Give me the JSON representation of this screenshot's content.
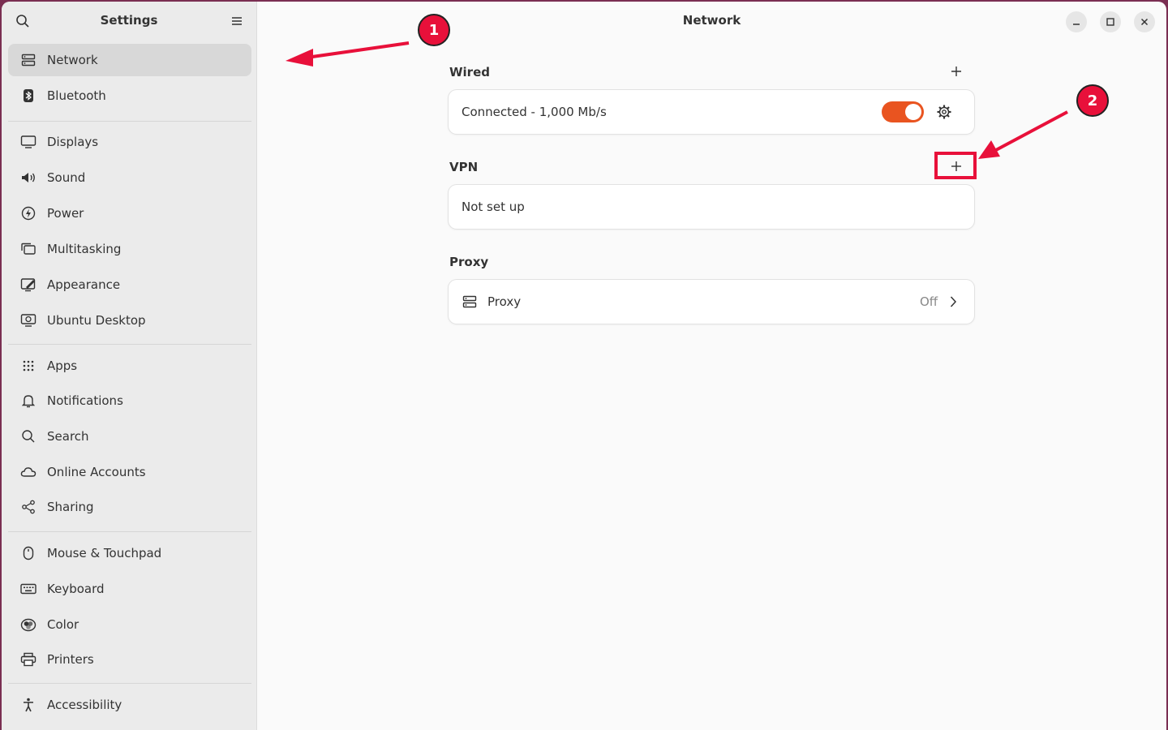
{
  "sidebar": {
    "title": "Settings",
    "items": [
      {
        "label": "Network",
        "icon": "network-icon",
        "selected": true
      },
      {
        "label": "Bluetooth",
        "icon": "bluetooth-icon"
      },
      {
        "label": "Displays",
        "icon": "display-icon"
      },
      {
        "label": "Sound",
        "icon": "speaker-icon"
      },
      {
        "label": "Power",
        "icon": "power-icon"
      },
      {
        "label": "Multitasking",
        "icon": "multitasking-icon"
      },
      {
        "label": "Appearance",
        "icon": "appearance-icon"
      },
      {
        "label": "Ubuntu Desktop",
        "icon": "ubuntu-desktop-icon"
      },
      {
        "label": "Apps",
        "icon": "apps-grid-icon"
      },
      {
        "label": "Notifications",
        "icon": "bell-icon"
      },
      {
        "label": "Search",
        "icon": "search-icon"
      },
      {
        "label": "Online Accounts",
        "icon": "cloud-icon"
      },
      {
        "label": "Sharing",
        "icon": "share-icon"
      },
      {
        "label": "Mouse & Touchpad",
        "icon": "mouse-icon"
      },
      {
        "label": "Keyboard",
        "icon": "keyboard-icon"
      },
      {
        "label": "Color",
        "icon": "color-icon"
      },
      {
        "label": "Printers",
        "icon": "printer-icon"
      },
      {
        "label": "Accessibility",
        "icon": "accessibility-icon"
      }
    ]
  },
  "main": {
    "title": "Network",
    "wired": {
      "label": "Wired",
      "status": "Connected - 1,000 Mb/s",
      "enabled": true
    },
    "vpn": {
      "label": "VPN",
      "status": "Not set up"
    },
    "proxy": {
      "section_label": "Proxy",
      "row_label": "Proxy",
      "status": "Off"
    }
  },
  "annotations": {
    "badge1": "1",
    "badge2": "2",
    "color": "#e8103a"
  },
  "colors": {
    "accent": "#e95420",
    "sidebar_bg": "#ebebeb",
    "selected_bg": "#d8d8d8"
  }
}
